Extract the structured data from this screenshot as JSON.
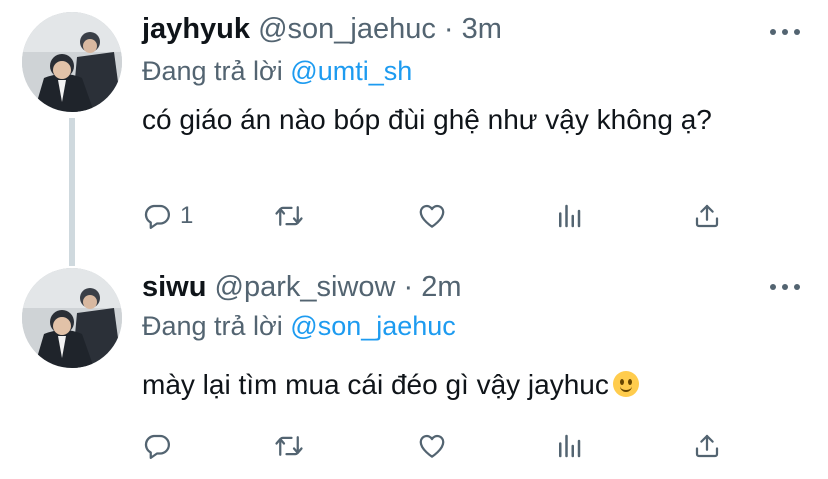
{
  "tweets": [
    {
      "name": "jayhyuk",
      "handle": "@son_jaehuc",
      "separator": "·",
      "time": "3m",
      "reply_prefix": "Đang trả lời",
      "reply_to": "@umti_sh",
      "text": "có giáo án nào bóp đùi ghệ như vậy không ạ?",
      "reply_count": "1",
      "icons": {
        "reply": "reply-icon",
        "retweet": "retweet-icon",
        "like": "heart-icon",
        "analytics": "analytics-icon",
        "share": "share-icon",
        "more": "more-icon"
      }
    },
    {
      "name": "siwu",
      "handle": "@park_siwow",
      "separator": "·",
      "time": "2m",
      "reply_prefix": "Đang trả lời",
      "reply_to": "@son_jaehuc",
      "text": "mày lại tìm mua cái đéo gì vậy jayhuc",
      "emoji": "slightly-smiling-face",
      "reply_count": "",
      "icons": {
        "reply": "reply-icon",
        "retweet": "retweet-icon",
        "like": "heart-icon",
        "analytics": "analytics-icon",
        "share": "share-icon",
        "more": "more-icon"
      }
    }
  ],
  "colors": {
    "text": "#0f1419",
    "secondary": "#536471",
    "mention": "#1d9bf0",
    "thread_line": "#cfd9de"
  }
}
